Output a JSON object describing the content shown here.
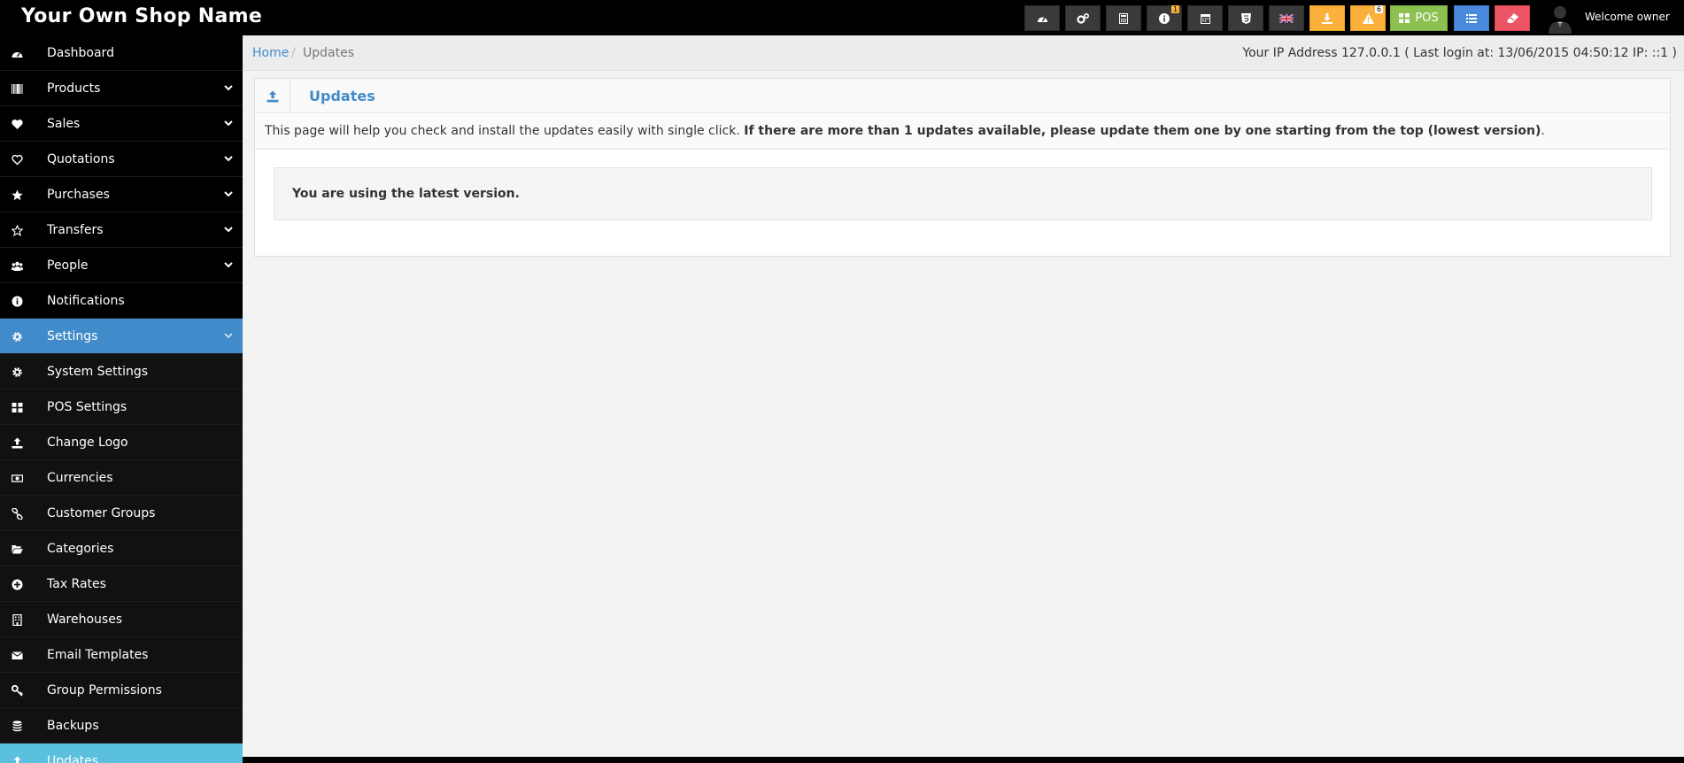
{
  "header": {
    "brand": "Your Own Shop Name",
    "welcome": "Welcome owner",
    "pos_label": "POS",
    "info_badge": "1",
    "alert_badge": "6"
  },
  "sidebar": {
    "items": [
      {
        "label": "Dashboard",
        "icon": "dashboard-icon"
      },
      {
        "label": "Products",
        "icon": "barcode-icon"
      },
      {
        "label": "Sales",
        "icon": "heart-icon"
      },
      {
        "label": "Quotations",
        "icon": "heart-outline-icon"
      },
      {
        "label": "Purchases",
        "icon": "star-icon"
      },
      {
        "label": "Transfers",
        "icon": "star-outline-icon"
      },
      {
        "label": "People",
        "icon": "users-icon"
      },
      {
        "label": "Notifications",
        "icon": "info-icon"
      },
      {
        "label": "Settings",
        "icon": "cog-icon"
      },
      {
        "label": "System Settings",
        "icon": "cog-icon"
      },
      {
        "label": "POS Settings",
        "icon": "th-large-icon"
      },
      {
        "label": "Change Logo",
        "icon": "upload-icon"
      },
      {
        "label": "Currencies",
        "icon": "money-icon"
      },
      {
        "label": "Customer Groups",
        "icon": "chain-icon"
      },
      {
        "label": "Categories",
        "icon": "folder-open-icon"
      },
      {
        "label": "Tax Rates",
        "icon": "plus-circle-icon"
      },
      {
        "label": "Warehouses",
        "icon": "building-icon"
      },
      {
        "label": "Email Templates",
        "icon": "envelope-icon"
      },
      {
        "label": "Group Permissions",
        "icon": "key-icon"
      },
      {
        "label": "Backups",
        "icon": "database-icon"
      },
      {
        "label": "Updates",
        "icon": "upload-icon"
      }
    ]
  },
  "breadcrumb": {
    "home": "Home",
    "separator": "/",
    "current": "Updates"
  },
  "ip_info": "Your IP Address 127.0.0.1 ( Last login at: 13/06/2015 04:50:12 IP: ::1 )",
  "panel": {
    "title": "Updates",
    "intro_text": "This page will help you check and install the updates easily with single click. ",
    "intro_bold": "If there are more than 1 updates available, please update them one by one starting from the top (lowest version)",
    "intro_end": ".",
    "status_message": "You are using the latest version."
  },
  "colors": {
    "active_nav": "#428bca",
    "current_nav": "#5bc0de",
    "link": "#428bca",
    "orange": "#fbb03b",
    "green": "#8cc152",
    "blue": "#4a89dc",
    "red": "#ed5565"
  }
}
